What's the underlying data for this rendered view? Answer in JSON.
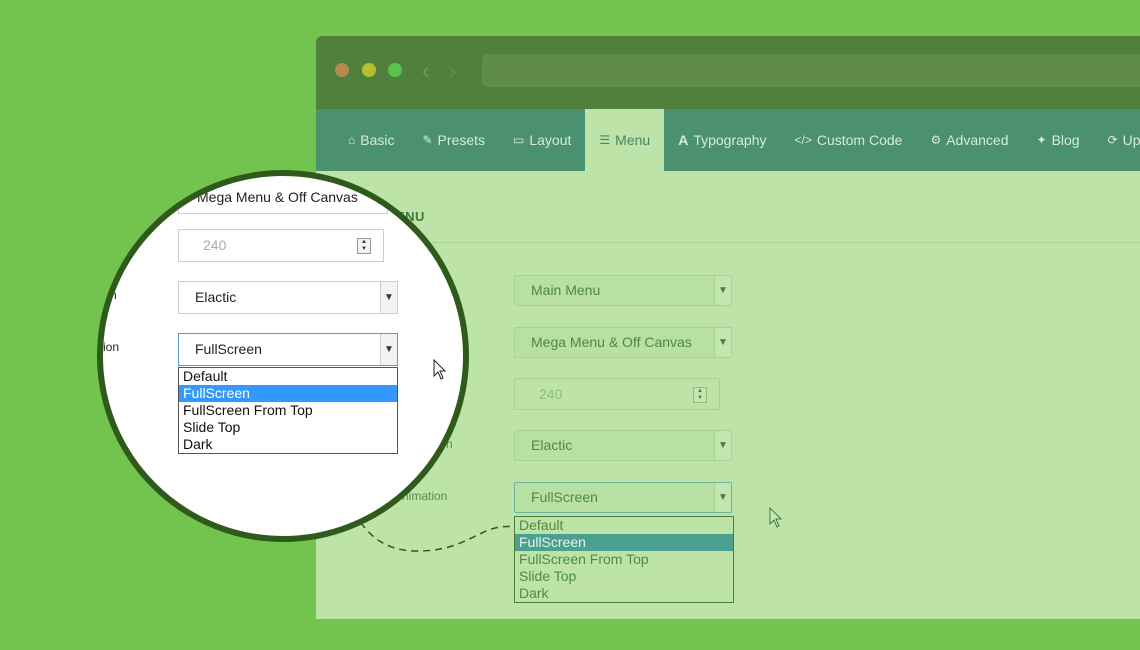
{
  "tabs": [
    {
      "icon": "home-icon",
      "glyph": "⌂",
      "label": "Basic"
    },
    {
      "icon": "brush-icon",
      "glyph": "✎",
      "label": "Presets"
    },
    {
      "icon": "layout-icon",
      "glyph": "▭",
      "label": "Layout"
    },
    {
      "icon": "list-icon",
      "glyph": "☰",
      "label": "Menu",
      "active": true
    },
    {
      "icon": "font-icon",
      "glyph": "A",
      "label": "Typography"
    },
    {
      "icon": "code-icon",
      "glyph": "</>",
      "label": "Custom Code"
    },
    {
      "icon": "gear-icon",
      "glyph": "⚙",
      "label": "Advanced"
    },
    {
      "icon": "pin-icon",
      "glyph": "✦",
      "label": "Blog"
    },
    {
      "icon": "refresh-icon",
      "glyph": "⟳",
      "label": "Up"
    }
  ],
  "section_title": "ENU",
  "fields": {
    "menu_select": "Main Menu",
    "menu_type_select": "Mega Menu & Off Canvas",
    "width_input": "240",
    "animation_label_fragment": "n",
    "animation_select": "Elactic",
    "offcanvas_label_fragment": "nimation",
    "offcanvas_select": "FullScreen"
  },
  "dropdown_options": [
    "Default",
    "FullScreen",
    "FullScreen From Top",
    "Slide Top",
    "Dark"
  ],
  "selected_option_index": 1,
  "magnifier": {
    "menu_type_select": "Mega Menu & Off Canvas",
    "width_input": "240",
    "animation_label_fragment": "n",
    "animation_select": "Elactic",
    "offcanvas_label_fragment": "ion",
    "offcanvas_select": "FullScreen"
  },
  "colors": {
    "background": "#73c44f",
    "titlebar": "#51803c",
    "tabbar": "#4b9170",
    "content": "#bde3a8",
    "selection_main": "#4ba090",
    "selection_magnifier": "#3399ff"
  }
}
